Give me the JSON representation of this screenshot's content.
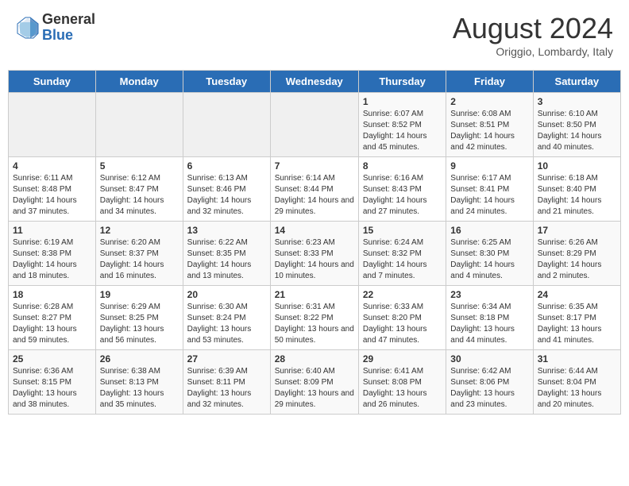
{
  "header": {
    "logo_general": "General",
    "logo_blue": "Blue",
    "month_title": "August 2024",
    "subtitle": "Origgio, Lombardy, Italy"
  },
  "weekdays": [
    "Sunday",
    "Monday",
    "Tuesday",
    "Wednesday",
    "Thursday",
    "Friday",
    "Saturday"
  ],
  "weeks": [
    [
      {
        "day": "",
        "info": ""
      },
      {
        "day": "",
        "info": ""
      },
      {
        "day": "",
        "info": ""
      },
      {
        "day": "",
        "info": ""
      },
      {
        "day": "1",
        "info": "Sunrise: 6:07 AM\nSunset: 8:52 PM\nDaylight: 14 hours and 45 minutes."
      },
      {
        "day": "2",
        "info": "Sunrise: 6:08 AM\nSunset: 8:51 PM\nDaylight: 14 hours and 42 minutes."
      },
      {
        "day": "3",
        "info": "Sunrise: 6:10 AM\nSunset: 8:50 PM\nDaylight: 14 hours and 40 minutes."
      }
    ],
    [
      {
        "day": "4",
        "info": "Sunrise: 6:11 AM\nSunset: 8:48 PM\nDaylight: 14 hours and 37 minutes."
      },
      {
        "day": "5",
        "info": "Sunrise: 6:12 AM\nSunset: 8:47 PM\nDaylight: 14 hours and 34 minutes."
      },
      {
        "day": "6",
        "info": "Sunrise: 6:13 AM\nSunset: 8:46 PM\nDaylight: 14 hours and 32 minutes."
      },
      {
        "day": "7",
        "info": "Sunrise: 6:14 AM\nSunset: 8:44 PM\nDaylight: 14 hours and 29 minutes."
      },
      {
        "day": "8",
        "info": "Sunrise: 6:16 AM\nSunset: 8:43 PM\nDaylight: 14 hours and 27 minutes."
      },
      {
        "day": "9",
        "info": "Sunrise: 6:17 AM\nSunset: 8:41 PM\nDaylight: 14 hours and 24 minutes."
      },
      {
        "day": "10",
        "info": "Sunrise: 6:18 AM\nSunset: 8:40 PM\nDaylight: 14 hours and 21 minutes."
      }
    ],
    [
      {
        "day": "11",
        "info": "Sunrise: 6:19 AM\nSunset: 8:38 PM\nDaylight: 14 hours and 18 minutes."
      },
      {
        "day": "12",
        "info": "Sunrise: 6:20 AM\nSunset: 8:37 PM\nDaylight: 14 hours and 16 minutes."
      },
      {
        "day": "13",
        "info": "Sunrise: 6:22 AM\nSunset: 8:35 PM\nDaylight: 14 hours and 13 minutes."
      },
      {
        "day": "14",
        "info": "Sunrise: 6:23 AM\nSunset: 8:33 PM\nDaylight: 14 hours and 10 minutes."
      },
      {
        "day": "15",
        "info": "Sunrise: 6:24 AM\nSunset: 8:32 PM\nDaylight: 14 hours and 7 minutes."
      },
      {
        "day": "16",
        "info": "Sunrise: 6:25 AM\nSunset: 8:30 PM\nDaylight: 14 hours and 4 minutes."
      },
      {
        "day": "17",
        "info": "Sunrise: 6:26 AM\nSunset: 8:29 PM\nDaylight: 14 hours and 2 minutes."
      }
    ],
    [
      {
        "day": "18",
        "info": "Sunrise: 6:28 AM\nSunset: 8:27 PM\nDaylight: 13 hours and 59 minutes."
      },
      {
        "day": "19",
        "info": "Sunrise: 6:29 AM\nSunset: 8:25 PM\nDaylight: 13 hours and 56 minutes."
      },
      {
        "day": "20",
        "info": "Sunrise: 6:30 AM\nSunset: 8:24 PM\nDaylight: 13 hours and 53 minutes."
      },
      {
        "day": "21",
        "info": "Sunrise: 6:31 AM\nSunset: 8:22 PM\nDaylight: 13 hours and 50 minutes."
      },
      {
        "day": "22",
        "info": "Sunrise: 6:33 AM\nSunset: 8:20 PM\nDaylight: 13 hours and 47 minutes."
      },
      {
        "day": "23",
        "info": "Sunrise: 6:34 AM\nSunset: 8:18 PM\nDaylight: 13 hours and 44 minutes."
      },
      {
        "day": "24",
        "info": "Sunrise: 6:35 AM\nSunset: 8:17 PM\nDaylight: 13 hours and 41 minutes."
      }
    ],
    [
      {
        "day": "25",
        "info": "Sunrise: 6:36 AM\nSunset: 8:15 PM\nDaylight: 13 hours and 38 minutes."
      },
      {
        "day": "26",
        "info": "Sunrise: 6:38 AM\nSunset: 8:13 PM\nDaylight: 13 hours and 35 minutes."
      },
      {
        "day": "27",
        "info": "Sunrise: 6:39 AM\nSunset: 8:11 PM\nDaylight: 13 hours and 32 minutes."
      },
      {
        "day": "28",
        "info": "Sunrise: 6:40 AM\nSunset: 8:09 PM\nDaylight: 13 hours and 29 minutes."
      },
      {
        "day": "29",
        "info": "Sunrise: 6:41 AM\nSunset: 8:08 PM\nDaylight: 13 hours and 26 minutes."
      },
      {
        "day": "30",
        "info": "Sunrise: 6:42 AM\nSunset: 8:06 PM\nDaylight: 13 hours and 23 minutes."
      },
      {
        "day": "31",
        "info": "Sunrise: 6:44 AM\nSunset: 8:04 PM\nDaylight: 13 hours and 20 minutes."
      }
    ]
  ]
}
